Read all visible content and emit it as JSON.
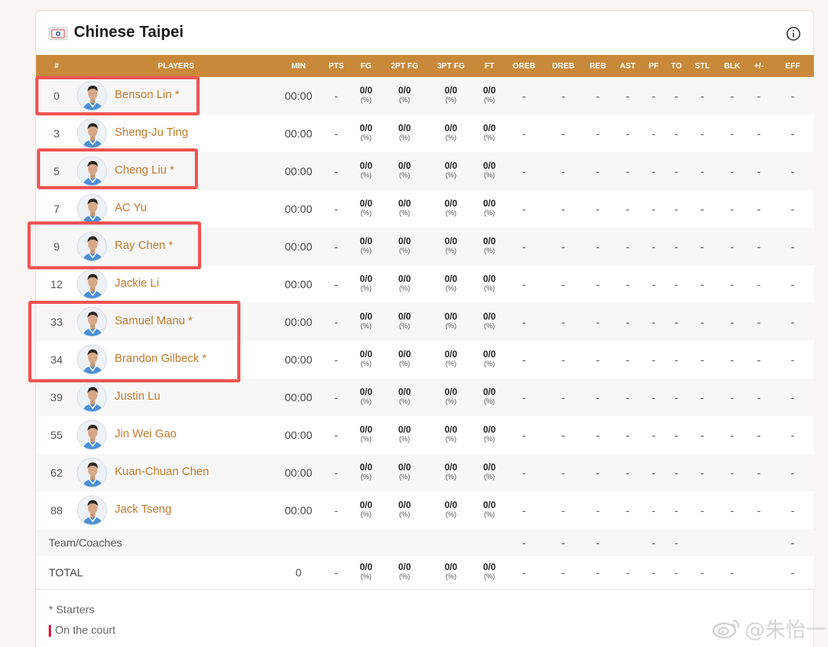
{
  "team": {
    "name": "Chinese Taipei"
  },
  "columns": [
    "#",
    "PLAYERS",
    "MIN",
    "PTS",
    "FG",
    "2PT FG",
    "3PT FG",
    "FT",
    "OREB",
    "DREB",
    "REB",
    "AST",
    "PF",
    "TO",
    "STL",
    "BLK",
    "+/-",
    "EFF"
  ],
  "players": [
    {
      "num": "0",
      "name": "Benson Lin *",
      "min": "00:00",
      "pts": "-",
      "fg": "0/0",
      "fg_pct": "(%)",
      "fg2": "0/0",
      "fg2_pct": "(%)",
      "fg3": "0/0",
      "fg3_pct": "(%)",
      "ft": "0/0",
      "ft_pct": "(%)",
      "oreb": "-",
      "dreb": "-",
      "reb": "-",
      "ast": "-",
      "pf": "-",
      "to": "-",
      "stl": "-",
      "blk": "-",
      "pm": "-",
      "eff": "-"
    },
    {
      "num": "3",
      "name": "Sheng-Ju Ting",
      "min": "00:00",
      "pts": "-",
      "fg": "0/0",
      "fg_pct": "(%)",
      "fg2": "0/0",
      "fg2_pct": "(%)",
      "fg3": "0/0",
      "fg3_pct": "(%)",
      "ft": "0/0",
      "ft_pct": "(%)",
      "oreb": "-",
      "dreb": "-",
      "reb": "-",
      "ast": "-",
      "pf": "-",
      "to": "-",
      "stl": "-",
      "blk": "-",
      "pm": "-",
      "eff": "-"
    },
    {
      "num": "5",
      "name": "Cheng Liu *",
      "min": "00:00",
      "pts": "-",
      "fg": "0/0",
      "fg_pct": "(%)",
      "fg2": "0/0",
      "fg2_pct": "(%)",
      "fg3": "0/0",
      "fg3_pct": "(%)",
      "ft": "0/0",
      "ft_pct": "(%)",
      "oreb": "-",
      "dreb": "-",
      "reb": "-",
      "ast": "-",
      "pf": "-",
      "to": "-",
      "stl": "-",
      "blk": "-",
      "pm": "-",
      "eff": "-"
    },
    {
      "num": "7",
      "name": "AC Yu",
      "min": "00:00",
      "pts": "-",
      "fg": "0/0",
      "fg_pct": "(%)",
      "fg2": "0/0",
      "fg2_pct": "(%)",
      "fg3": "0/0",
      "fg3_pct": "(%)",
      "ft": "0/0",
      "ft_pct": "(%)",
      "oreb": "-",
      "dreb": "-",
      "reb": "-",
      "ast": "-",
      "pf": "-",
      "to": "-",
      "stl": "-",
      "blk": "-",
      "pm": "-",
      "eff": "-"
    },
    {
      "num": "9",
      "name": "Ray Chen *",
      "min": "00:00",
      "pts": "-",
      "fg": "0/0",
      "fg_pct": "(%)",
      "fg2": "0/0",
      "fg2_pct": "(%)",
      "fg3": "0/0",
      "fg3_pct": "(%)",
      "ft": "0/0",
      "ft_pct": "(%)",
      "oreb": "-",
      "dreb": "-",
      "reb": "-",
      "ast": "-",
      "pf": "-",
      "to": "-",
      "stl": "-",
      "blk": "-",
      "pm": "-",
      "eff": "-"
    },
    {
      "num": "12",
      "name": "Jackie Li",
      "min": "00:00",
      "pts": "-",
      "fg": "0/0",
      "fg_pct": "(%)",
      "fg2": "0/0",
      "fg2_pct": "(%)",
      "fg3": "0/0",
      "fg3_pct": "(%)",
      "ft": "0/0",
      "ft_pct": "(%)",
      "oreb": "-",
      "dreb": "-",
      "reb": "-",
      "ast": "-",
      "pf": "-",
      "to": "-",
      "stl": "-",
      "blk": "-",
      "pm": "-",
      "eff": "-"
    },
    {
      "num": "33",
      "name": "Samuel Manu *",
      "min": "00:00",
      "pts": "-",
      "fg": "0/0",
      "fg_pct": "(%)",
      "fg2": "0/0",
      "fg2_pct": "(%)",
      "fg3": "0/0",
      "fg3_pct": "(%)",
      "ft": "0/0",
      "ft_pct": "(%)",
      "oreb": "-",
      "dreb": "-",
      "reb": "-",
      "ast": "-",
      "pf": "-",
      "to": "-",
      "stl": "-",
      "blk": "-",
      "pm": "-",
      "eff": "-"
    },
    {
      "num": "34",
      "name": "Brandon Gilbeck *",
      "min": "00:00",
      "pts": "-",
      "fg": "0/0",
      "fg_pct": "(%)",
      "fg2": "0/0",
      "fg2_pct": "(%)",
      "fg3": "0/0",
      "fg3_pct": "(%)",
      "ft": "0/0",
      "ft_pct": "(%)",
      "oreb": "-",
      "dreb": "-",
      "reb": "-",
      "ast": "-",
      "pf": "-",
      "to": "-",
      "stl": "-",
      "blk": "-",
      "pm": "-",
      "eff": "-"
    },
    {
      "num": "39",
      "name": "Justin Lu",
      "min": "00:00",
      "pts": "-",
      "fg": "0/0",
      "fg_pct": "(%)",
      "fg2": "0/0",
      "fg2_pct": "(%)",
      "fg3": "0/0",
      "fg3_pct": "(%)",
      "ft": "0/0",
      "ft_pct": "(%)",
      "oreb": "-",
      "dreb": "-",
      "reb": "-",
      "ast": "-",
      "pf": "-",
      "to": "-",
      "stl": "-",
      "blk": "-",
      "pm": "-",
      "eff": "-"
    },
    {
      "num": "55",
      "name": "Jin Wei Gao",
      "min": "00:00",
      "pts": "-",
      "fg": "0/0",
      "fg_pct": "(%)",
      "fg2": "0/0",
      "fg2_pct": "(%)",
      "fg3": "0/0",
      "fg3_pct": "(%)",
      "ft": "0/0",
      "ft_pct": "(%)",
      "oreb": "-",
      "dreb": "-",
      "reb": "-",
      "ast": "-",
      "pf": "-",
      "to": "-",
      "stl": "-",
      "blk": "-",
      "pm": "-",
      "eff": "-"
    },
    {
      "num": "62",
      "name": "Kuan-Chuan Chen",
      "min": "00:00",
      "pts": "-",
      "fg": "0/0",
      "fg_pct": "(%)",
      "fg2": "0/0",
      "fg2_pct": "(%)",
      "fg3": "0/0",
      "fg3_pct": "(%)",
      "ft": "0/0",
      "ft_pct": "(%)",
      "oreb": "-",
      "dreb": "-",
      "reb": "-",
      "ast": "-",
      "pf": "-",
      "to": "-",
      "stl": "-",
      "blk": "-",
      "pm": "-",
      "eff": "-"
    },
    {
      "num": "88",
      "name": "Jack Tseng",
      "min": "00:00",
      "pts": "-",
      "fg": "0/0",
      "fg_pct": "(%)",
      "fg2": "0/0",
      "fg2_pct": "(%)",
      "fg3": "0/0",
      "fg3_pct": "(%)",
      "ft": "0/0",
      "ft_pct": "(%)",
      "oreb": "-",
      "dreb": "-",
      "reb": "-",
      "ast": "-",
      "pf": "-",
      "to": "-",
      "stl": "-",
      "blk": "-",
      "pm": "-",
      "eff": "-"
    }
  ],
  "coaches_row": {
    "label": "Team/Coaches",
    "oreb": "-",
    "dreb": "-",
    "reb": "-",
    "pf": "-",
    "to": "-",
    "eff": "-"
  },
  "total_row": {
    "label": "TOTAL",
    "min": "0",
    "pts": "-",
    "fg": "0/0",
    "fg_pct": "(%)",
    "fg2": "0/0",
    "fg2_pct": "(%)",
    "fg3": "0/0",
    "fg3_pct": "(%)",
    "ft": "0/0",
    "ft_pct": "(%)",
    "oreb": "-",
    "dreb": "-",
    "reb": "-",
    "ast": "-",
    "pf": "-",
    "to": "-",
    "stl": "-",
    "blk": "-",
    "eff": "-"
  },
  "legend": {
    "starters": "* Starters",
    "on_court": "On the court"
  },
  "watermark": {
    "text": "@朱怡一"
  },
  "colors": {
    "header_bg": "#c8893a",
    "player_name": "#c07a2c",
    "highlight": "#f05454",
    "on_court_bar": "#e0173a"
  }
}
